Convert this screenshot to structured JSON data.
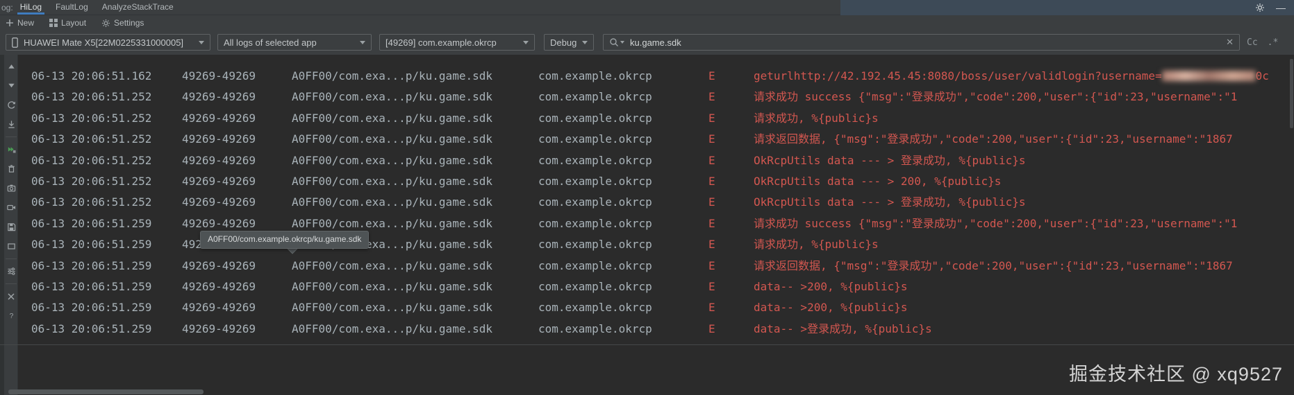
{
  "colors": {
    "accent_red": "#d35750",
    "muted_text": "#a9b3b9",
    "tab_underline": "#3f7cbf",
    "resume_green": "#4a9c54",
    "titlebar_blue": "#3d4a57"
  },
  "tabbar": {
    "og_label": "og:",
    "tabs": [
      {
        "label": "HiLog",
        "active": true
      },
      {
        "label": "FaultLog",
        "active": false
      },
      {
        "label": "AnalyzeStackTrace",
        "active": false
      }
    ],
    "window_controls": {
      "minimize": "—"
    }
  },
  "toolbar": {
    "new_label": "New",
    "layout_label": "Layout",
    "settings_label": "Settings"
  },
  "filters": {
    "device": {
      "value": "HUAWEI Mate X5[22M0225331000005]"
    },
    "scope": {
      "value": "All logs of selected app"
    },
    "process": {
      "value": "[49269] com.example.okrcp"
    },
    "level": {
      "value": "Debug"
    },
    "search": {
      "value": "ku.game.sdk",
      "clear_label": "✕",
      "case_label": "Cc",
      "regex_label": ".*"
    }
  },
  "left_toolbar": {
    "icons": [
      {
        "name": "scroll-to-top"
      },
      {
        "name": "scroll-to-end"
      },
      {
        "name": "restart"
      },
      {
        "name": "export-log",
        "sep_after": true
      },
      {
        "name": "resume"
      },
      {
        "name": "clear-log"
      },
      {
        "name": "screenshot"
      },
      {
        "name": "screen-record"
      },
      {
        "name": "save-log"
      },
      {
        "name": "soft-wrap",
        "sep_after": true
      },
      {
        "name": "filter-settings",
        "sep_after": true
      },
      {
        "name": "close"
      },
      {
        "name": "help"
      }
    ]
  },
  "log": {
    "rows": [
      {
        "time": "06-13 20:06:51.162",
        "pid_tid": "49269-49269",
        "tag": "A0FF00/com.exa...p/ku.game.sdk",
        "pkg": "com.example.okrcp",
        "level": "E",
        "msg": "geturlhttp://42.192.45.45:8080/boss/user/validlogin?username=",
        "msg_blur": true,
        "msg_after": "0c"
      },
      {
        "time": "06-13 20:06:51.252",
        "pid_tid": "49269-49269",
        "tag": "A0FF00/com.exa...p/ku.game.sdk",
        "pkg": "com.example.okrcp",
        "level": "E",
        "msg": "请求成功 success {\"msg\":\"登录成功\",\"code\":200,\"user\":{\"id\":23,\"username\":\"1"
      },
      {
        "time": "06-13 20:06:51.252",
        "pid_tid": "49269-49269",
        "tag": "A0FF00/com.exa...p/ku.game.sdk",
        "pkg": "com.example.okrcp",
        "level": "E",
        "msg": "请求成功, %{public}s"
      },
      {
        "time": "06-13 20:06:51.252",
        "pid_tid": "49269-49269",
        "tag": "A0FF00/com.exa...p/ku.game.sdk",
        "pkg": "com.example.okrcp",
        "level": "E",
        "msg": "请求返回数据, {\"msg\":\"登录成功\",\"code\":200,\"user\":{\"id\":23,\"username\":\"1867"
      },
      {
        "time": "06-13 20:06:51.252",
        "pid_tid": "49269-49269",
        "tag": "A0FF00/com.exa...p/ku.game.sdk",
        "pkg": "com.example.okrcp",
        "level": "E",
        "msg": "OkRcpUtils data --- > 登录成功, %{public}s"
      },
      {
        "time": "06-13 20:06:51.252",
        "pid_tid": "49269-49269",
        "tag": "A0FF00/com.exa...p/ku.game.sdk",
        "pkg": "com.example.okrcp",
        "level": "E",
        "msg": "OkRcpUtils data --- > 200, %{public}s"
      },
      {
        "time": "06-13 20:06:51.252",
        "pid_tid": "49269-49269",
        "tag": "A0FF00/com.exa...p/ku.game.sdk",
        "pkg": "com.example.okrcp",
        "level": "E",
        "msg": "OkRcpUtils data --- > 登录成功, %{public}s"
      },
      {
        "time": "06-13 20:06:51.259",
        "pid_tid": "49269-49269",
        "tag": "A0FF00/com.exa...p/ku.game.sdk",
        "pkg": "com.example.okrcp",
        "level": "E",
        "msg": "请求成功 success {\"msg\":\"登录成功\",\"code\":200,\"user\":{\"id\":23,\"username\":\"1"
      },
      {
        "time": "06-13 20:06:51.259",
        "pid_tid": "49269-49269",
        "tag": "A0FF00/com.exa...p/ku.game.sdk",
        "pkg": "com.example.okrcp",
        "level": "E",
        "msg": "请求成功, %{public}s"
      },
      {
        "time": "06-13 20:06:51.259",
        "pid_tid": "49269-49269",
        "tag": "A0FF00/com.exa...p/ku.game.sdk",
        "pkg": "com.example.okrcp",
        "level": "E",
        "msg": "请求返回数据, {\"msg\":\"登录成功\",\"code\":200,\"user\":{\"id\":23,\"username\":\"1867"
      },
      {
        "time": "06-13 20:06:51.259",
        "pid_tid": "49269-49269",
        "tag": "A0FF00/com.exa...p/ku.game.sdk",
        "pkg": "com.example.okrcp",
        "level": "E",
        "msg": "data-- >200, %{public}s"
      },
      {
        "time": "06-13 20:06:51.259",
        "pid_tid": "49269-49269",
        "tag": "A0FF00/com.exa...p/ku.game.sdk",
        "pkg": "com.example.okrcp",
        "level": "E",
        "msg": "data-- >200, %{public}s"
      },
      {
        "time": "06-13 20:06:51.259",
        "pid_tid": "49269-49269",
        "tag": "A0FF00/com.exa...p/ku.game.sdk",
        "pkg": "com.example.okrcp",
        "level": "E",
        "msg": "data-- >登录成功, %{public}s"
      }
    ]
  },
  "tooltip": {
    "text": "A0FF00/com.example.okrcp/ku.game.sdk"
  },
  "watermark": {
    "text": "掘金技术社区 @ xq9527"
  }
}
